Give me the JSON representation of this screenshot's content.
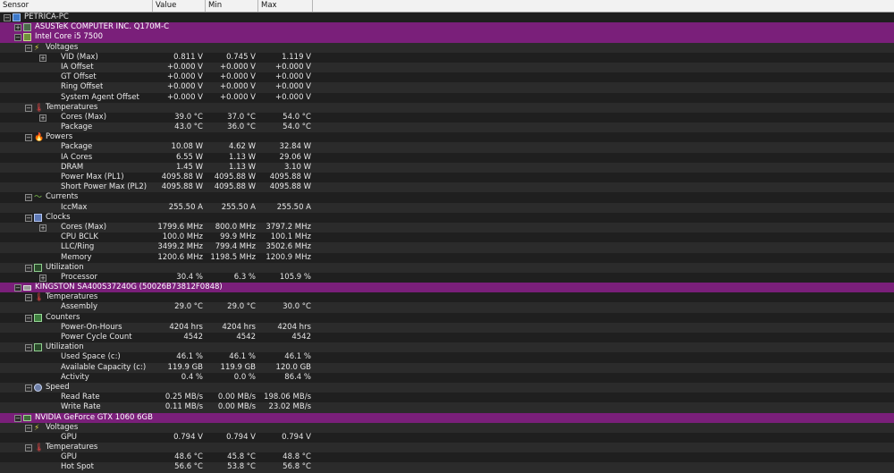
{
  "header": {
    "sensor": "Sensor",
    "value": "Value",
    "min": "Min",
    "max": "Max"
  },
  "rows": [
    {
      "depth": 0,
      "exp": "−",
      "icon": "ico-pc",
      "name": "PETRICA-PC",
      "type": "root"
    },
    {
      "depth": 1,
      "exp": "+",
      "icon": "ico-board",
      "name": "ASUSTeK COMPUTER INC. Q170M-C",
      "type": "group"
    },
    {
      "depth": 1,
      "exp": "−",
      "icon": "ico-cpu",
      "name": "Intel Core i5 7500",
      "type": "group"
    },
    {
      "depth": 2,
      "exp": "−",
      "icon": "ico-volt",
      "name": "Voltages",
      "type": "cat"
    },
    {
      "depth": 3,
      "exp": "+",
      "name": "VID (Max)",
      "v": "0.811 V",
      "mn": "0.745 V",
      "mx": "1.119 V"
    },
    {
      "depth": 3,
      "name": "IA Offset",
      "v": "+0.000 V",
      "mn": "+0.000 V",
      "mx": "+0.000 V"
    },
    {
      "depth": 3,
      "name": "GT Offset",
      "v": "+0.000 V",
      "mn": "+0.000 V",
      "mx": "+0.000 V"
    },
    {
      "depth": 3,
      "name": "Ring Offset",
      "v": "+0.000 V",
      "mn": "+0.000 V",
      "mx": "+0.000 V"
    },
    {
      "depth": 3,
      "name": "System Agent Offset",
      "v": "+0.000 V",
      "mn": "+0.000 V",
      "mx": "+0.000 V"
    },
    {
      "depth": 2,
      "exp": "−",
      "icon": "ico-temp",
      "name": "Temperatures",
      "type": "cat"
    },
    {
      "depth": 3,
      "exp": "+",
      "name": "Cores (Max)",
      "v": "39.0 °C",
      "mn": "37.0 °C",
      "mx": "54.0 °C"
    },
    {
      "depth": 3,
      "name": "Package",
      "v": "43.0 °C",
      "mn": "36.0 °C",
      "mx": "54.0 °C"
    },
    {
      "depth": 2,
      "exp": "−",
      "icon": "ico-power",
      "name": "Powers",
      "type": "cat"
    },
    {
      "depth": 3,
      "name": "Package",
      "v": "10.08 W",
      "mn": "4.62 W",
      "mx": "32.84 W"
    },
    {
      "depth": 3,
      "name": "IA Cores",
      "v": "6.55 W",
      "mn": "1.13 W",
      "mx": "29.06 W"
    },
    {
      "depth": 3,
      "name": "DRAM",
      "v": "1.45 W",
      "mn": "1.13 W",
      "mx": "3.10 W"
    },
    {
      "depth": 3,
      "name": "Power Max (PL1)",
      "v": "4095.88 W",
      "mn": "4095.88 W",
      "mx": "4095.88 W"
    },
    {
      "depth": 3,
      "name": "Short Power Max (PL2)",
      "v": "4095.88 W",
      "mn": "4095.88 W",
      "mx": "4095.88 W"
    },
    {
      "depth": 2,
      "exp": "−",
      "icon": "ico-curr",
      "name": "Currents",
      "type": "cat"
    },
    {
      "depth": 3,
      "name": "IccMax",
      "v": "255.50 A",
      "mn": "255.50 A",
      "mx": "255.50 A"
    },
    {
      "depth": 2,
      "exp": "−",
      "icon": "ico-clock",
      "name": "Clocks",
      "type": "cat"
    },
    {
      "depth": 3,
      "exp": "+",
      "name": "Cores (Max)",
      "v": "1799.6 MHz",
      "mn": "800.0 MHz",
      "mx": "3797.2 MHz"
    },
    {
      "depth": 3,
      "name": "CPU BCLK",
      "v": "100.0 MHz",
      "mn": "99.9 MHz",
      "mx": "100.1 MHz"
    },
    {
      "depth": 3,
      "name": "LLC/Ring",
      "v": "3499.2 MHz",
      "mn": "799.4 MHz",
      "mx": "3502.6 MHz"
    },
    {
      "depth": 3,
      "name": "Memory",
      "v": "1200.6 MHz",
      "mn": "1198.5 MHz",
      "mx": "1200.9 MHz"
    },
    {
      "depth": 2,
      "exp": "−",
      "icon": "ico-util",
      "name": "Utilization",
      "type": "cat"
    },
    {
      "depth": 3,
      "exp": "+",
      "name": "Processor",
      "v": "30.4 %",
      "mn": "6.3 %",
      "mx": "105.9 %"
    },
    {
      "depth": 1,
      "exp": "−",
      "icon": "ico-disk",
      "name": "KINGSTON SA400S37240G (50026B73812F0848)",
      "type": "group"
    },
    {
      "depth": 2,
      "exp": "−",
      "icon": "ico-temp",
      "name": "Temperatures",
      "type": "cat"
    },
    {
      "depth": 3,
      "name": "Assembly",
      "v": "29.0 °C",
      "mn": "29.0 °C",
      "mx": "30.0 °C"
    },
    {
      "depth": 2,
      "exp": "−",
      "icon": "ico-count",
      "name": "Counters",
      "type": "cat"
    },
    {
      "depth": 3,
      "name": "Power-On-Hours",
      "v": "4204 hrs",
      "mn": "4204 hrs",
      "mx": "4204 hrs"
    },
    {
      "depth": 3,
      "name": "Power Cycle Count",
      "v": "4542",
      "mn": "4542",
      "mx": "4542"
    },
    {
      "depth": 2,
      "exp": "−",
      "icon": "ico-util",
      "name": "Utilization",
      "type": "cat"
    },
    {
      "depth": 3,
      "name": "Used Space (c:)",
      "v": "46.1 %",
      "mn": "46.1 %",
      "mx": "46.1 %"
    },
    {
      "depth": 3,
      "name": "Available Capacity (c:)",
      "v": "119.9 GB",
      "mn": "119.9 GB",
      "mx": "120.0 GB"
    },
    {
      "depth": 3,
      "name": "Activity",
      "v": "0.4 %",
      "mn": "0.0 %",
      "mx": "86.4 %"
    },
    {
      "depth": 2,
      "exp": "−",
      "icon": "ico-speed",
      "name": "Speed",
      "type": "cat"
    },
    {
      "depth": 3,
      "name": "Read Rate",
      "v": "0.25 MB/s",
      "mn": "0.00 MB/s",
      "mx": "198.06 MB/s"
    },
    {
      "depth": 3,
      "name": "Write Rate",
      "v": "0.11 MB/s",
      "mn": "0.00 MB/s",
      "mx": "23.02 MB/s"
    },
    {
      "depth": 1,
      "exp": "−",
      "icon": "ico-gpu",
      "name": "NVIDIA GeForce GTX 1060 6GB",
      "type": "group"
    },
    {
      "depth": 2,
      "exp": "−",
      "icon": "ico-volt",
      "name": "Voltages",
      "type": "cat"
    },
    {
      "depth": 3,
      "name": "GPU",
      "v": "0.794 V",
      "mn": "0.794 V",
      "mx": "0.794 V"
    },
    {
      "depth": 2,
      "exp": "−",
      "icon": "ico-temp",
      "name": "Temperatures",
      "type": "cat"
    },
    {
      "depth": 3,
      "name": "GPU",
      "v": "48.6 °C",
      "mn": "45.8 °C",
      "mx": "48.8 °C"
    },
    {
      "depth": 3,
      "name": "Hot Spot",
      "v": "56.6 °C",
      "mn": "53.8 °C",
      "mx": "56.8 °C"
    }
  ]
}
